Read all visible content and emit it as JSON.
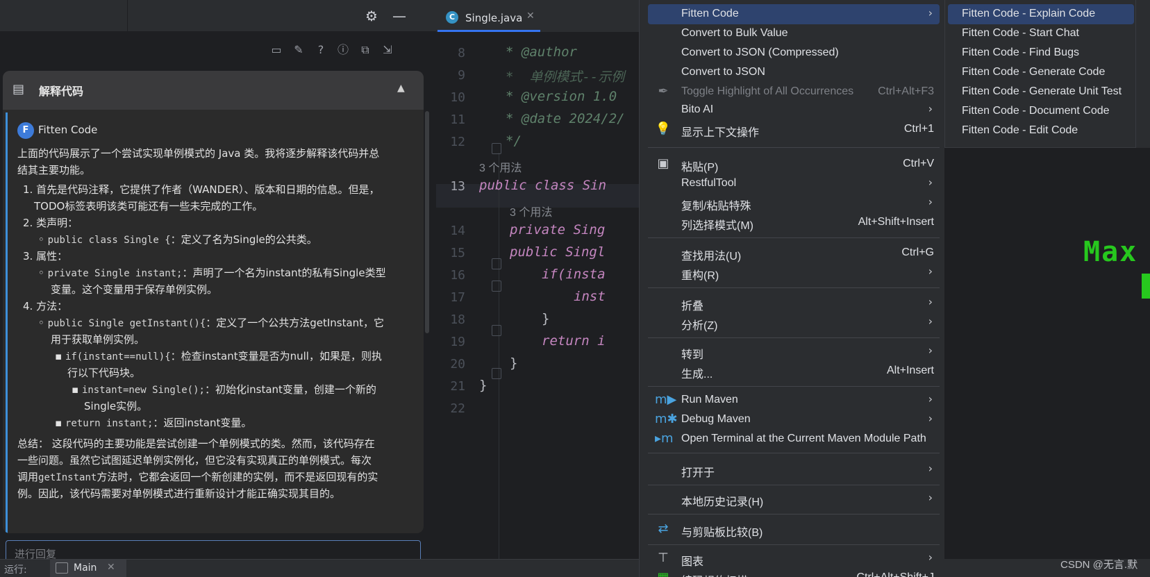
{
  "left_panel": {
    "settings_icon": "gear-icon",
    "minimize_icon": "minus-icon",
    "toolbar_icons": [
      "chat-bubble-icon",
      "magic-wand-icon",
      "help-icon",
      "info-icon",
      "copy-icon",
      "export-icon"
    ],
    "header_title": "解释代码",
    "author": "Fitten Code",
    "paragraphs": {
      "intro_1": "上面的代码展示了一个尝试实现单例模式的 Java 类。我将逐步解释该代码并总",
      "intro_2": "结其主要功能。",
      "item1_1": "1. 首先是代码注释，它提供了作者（WANDER）、版本和日期的信息。但是，",
      "item1_2": "TODO标签表明该类可能还有一些未完成的工作。",
      "item2": "2. 类声明：",
      "item2_code": "public class Single {",
      "item2_desc": "：定义了名为Single的公共类。",
      "item3": "3. 属性：",
      "item3_code": "private Single instant;",
      "item3_desc": "：声明了一个名为instant的私有Single类型",
      "item3_desc2": "变量。这个变量用于保存单例实例。",
      "item4": "4. 方法：",
      "item4_code": "public Single getInstant(){",
      "item4_desc": "：定义了一个公共方法getInstant，它",
      "item4_desc2": "用于获取单例实例。",
      "item4a_code": "if(instant==null){",
      "item4a_desc": "：检查instant变量是否为null，如果是，则执",
      "item4a_desc2": "行以下代码块。",
      "item4b_code": "instant=new Single();",
      "item4b_desc": "：初始化instant变量，创建一个新的",
      "item4b_desc2": "Single实例。",
      "item4c_code": "return instant;",
      "item4c_desc": "：返回instant变量。",
      "summary_1": "总结： 这段代码的主要功能是尝试创建一个单例模式的类。然而，该代码存在",
      "summary_2": "一些问题。虽然它试图延迟单例实例化，但它没有实现真正的单例模式。每次",
      "summary_3a": "调用",
      "summary_3_code": "getInstant",
      "summary_3b": "方法时，它都会返回一个新创建的实例，而不是返回现有的实",
      "summary_4": "例。因此，该代码需要对单例模式进行重新设计才能正确实现其目的。"
    },
    "input_placeholder": "进行回复"
  },
  "editor": {
    "tab_label": "Single.java",
    "lines": [
      {
        "num": "8",
        "code": "* @author"
      },
      {
        "num": "9",
        "code": "*  单例模式--示例"
      },
      {
        "num": "10",
        "code": "* @version 1.0"
      },
      {
        "num": "11",
        "code": "* @date 2024/2/"
      },
      {
        "num": "12",
        "code": "*/"
      },
      {
        "num": "",
        "code": "3 个用法"
      },
      {
        "num": "13",
        "code": "public class Sin"
      },
      {
        "num": "",
        "code": "3 个用法"
      },
      {
        "num": "14",
        "code": "private Sing"
      },
      {
        "num": "15",
        "code": "public Singl"
      },
      {
        "num": "16",
        "code": "if(insta"
      },
      {
        "num": "17",
        "code": "inst"
      },
      {
        "num": "18",
        "code": "}"
      },
      {
        "num": "19",
        "code": "return i"
      },
      {
        "num": "20",
        "code": "}"
      },
      {
        "num": "21",
        "code": "}"
      },
      {
        "num": "22",
        "code": ""
      }
    ]
  },
  "context_menu": {
    "items": [
      {
        "label": "Fitten Code",
        "submenu": true
      },
      {
        "label": "Convert to Bulk Value"
      },
      {
        "label": "Convert to JSON (Compressed)"
      },
      {
        "label": "Convert to JSON"
      },
      {
        "label": "Toggle Highlight of All Occurrences",
        "shortcut": "Ctrl+Alt+F3",
        "disabled": true
      },
      {
        "label": "Bito AI",
        "submenu": true
      },
      {
        "label": "显示上下文操作",
        "shortcut": "Ctrl+1"
      },
      {
        "label": "粘贴(P)",
        "shortcut": "Ctrl+V"
      },
      {
        "label": "RestfulTool",
        "submenu": true
      },
      {
        "label": "复制/粘贴特殊",
        "submenu": true
      },
      {
        "label": "列选择模式(M)",
        "shortcut": "Alt+Shift+Insert"
      },
      {
        "label": "查找用法(U)",
        "shortcut": "Ctrl+G"
      },
      {
        "label": "重构(R)",
        "submenu": true
      },
      {
        "label": "折叠",
        "submenu": true
      },
      {
        "label": "分析(Z)",
        "submenu": true
      },
      {
        "label": "转到",
        "submenu": true
      },
      {
        "label": "生成...",
        "shortcut": "Alt+Insert"
      },
      {
        "label": "Run Maven",
        "submenu": true
      },
      {
        "label": "Debug Maven",
        "submenu": true
      },
      {
        "label": "Open Terminal at the Current Maven Module Path"
      },
      {
        "label": "打开于",
        "submenu": true
      },
      {
        "label": "本地历史记录(H)",
        "submenu": true
      },
      {
        "label": "与剪贴板比较(B)"
      },
      {
        "label": "图表",
        "submenu": true
      },
      {
        "label": "编码规约扫描",
        "shortcut": "Ctrl+Alt+Shift+J"
      }
    ]
  },
  "submenu": {
    "items": [
      "Fitten Code - Explain Code",
      "Fitten Code - Start Chat",
      "Fitten Code - Find Bugs",
      "Fitten Code - Generate Code",
      "Fitten Code - Generate Unit Test",
      "Fitten Code - Document Code",
      "Fitten Code - Edit Code"
    ]
  },
  "background": {
    "max_text": "Max",
    "watermark": "CSDN @无言.默"
  },
  "bottom_bar": {
    "run_label": "运行:",
    "tab_label": "Main"
  },
  "colors": {
    "accent": "#3574f0",
    "highlight": "#2e436e",
    "green": "#27c81e"
  }
}
